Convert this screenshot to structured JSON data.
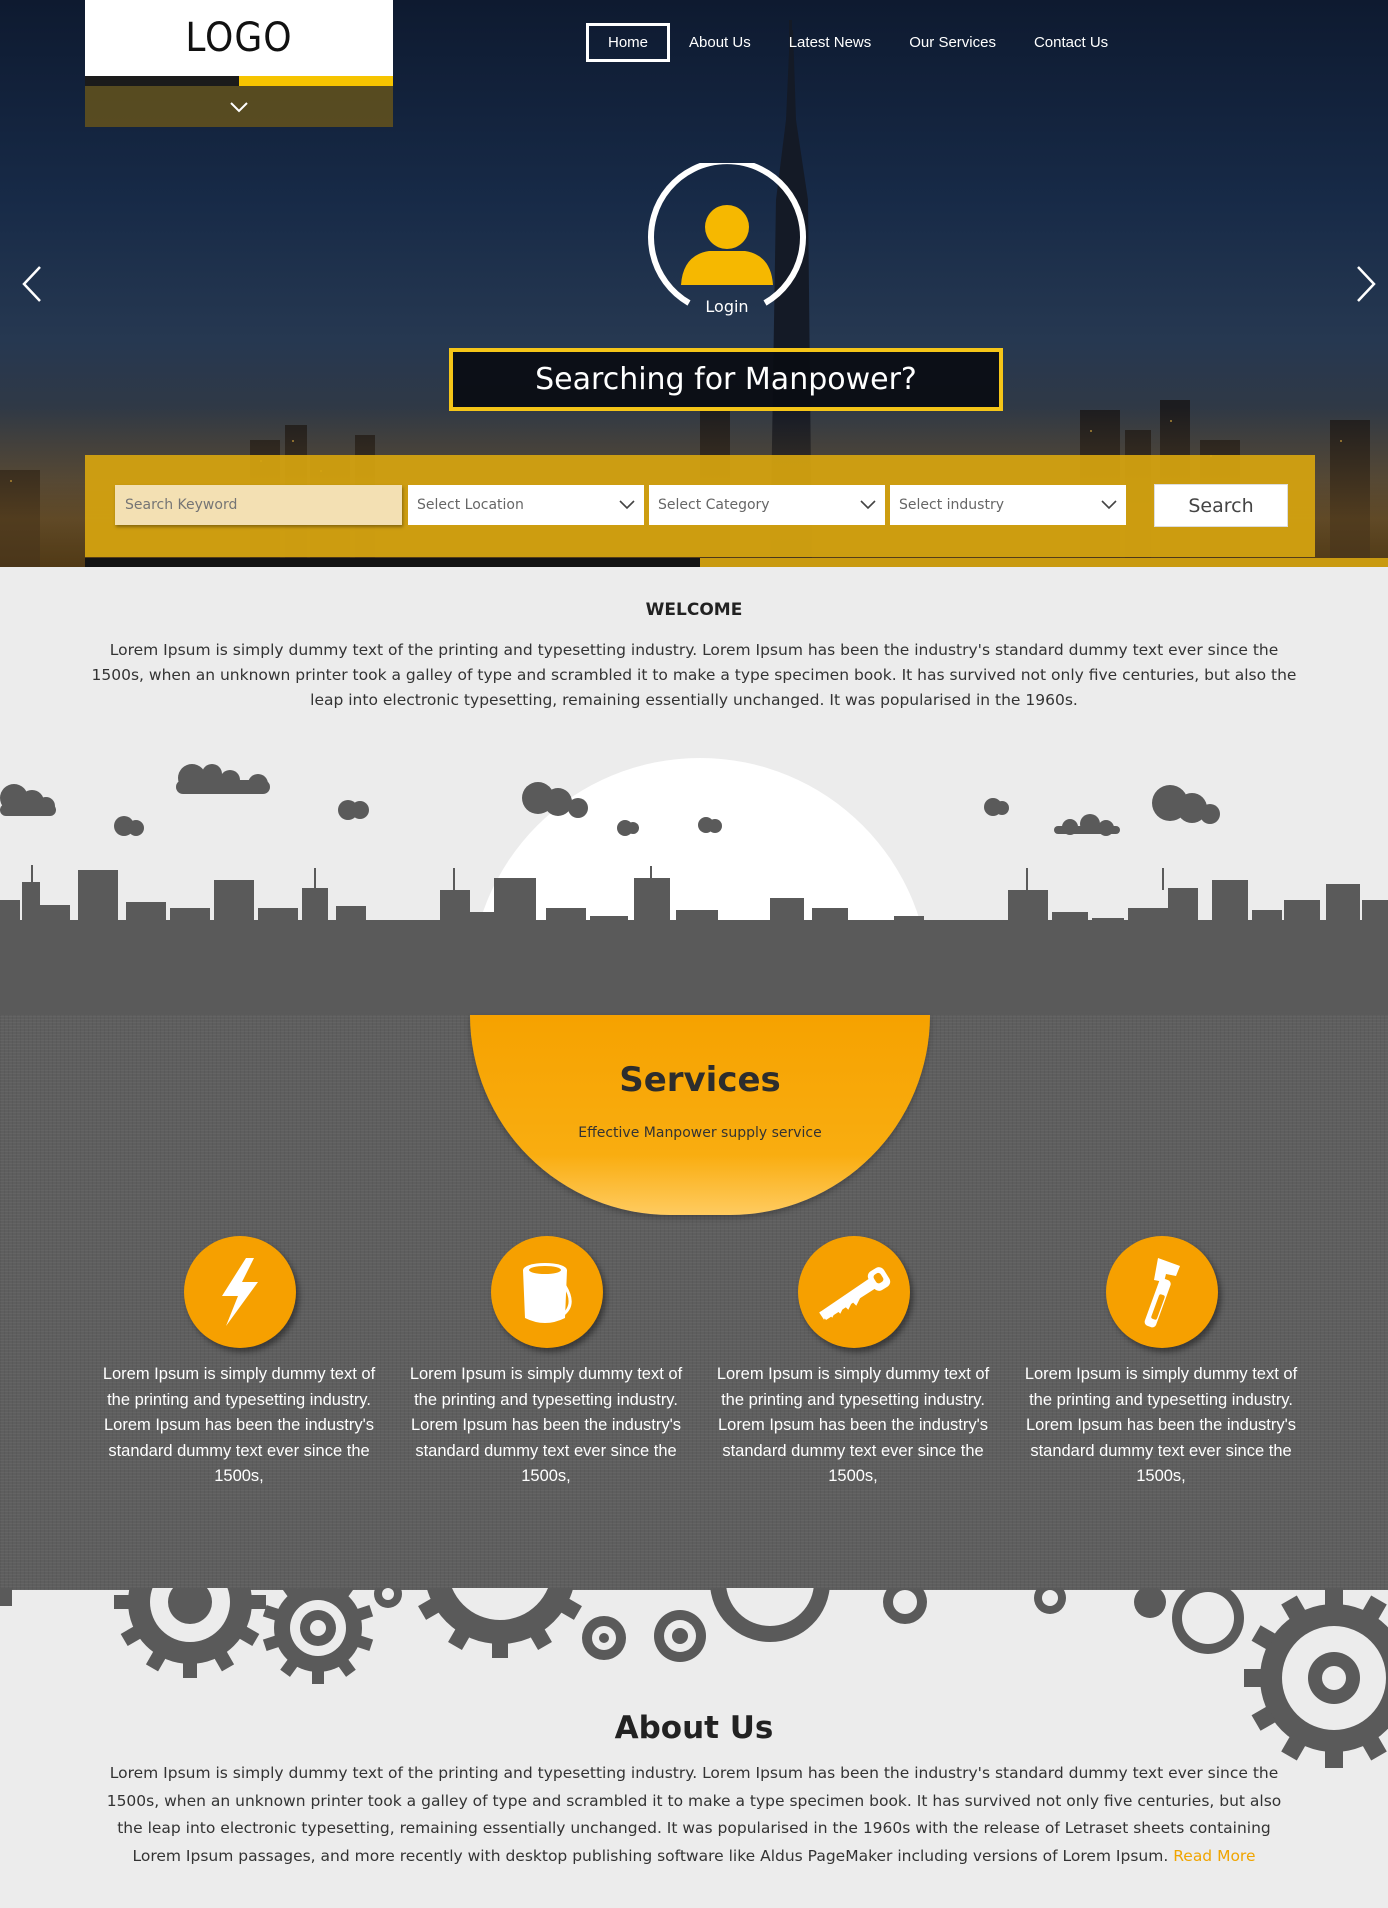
{
  "header": {
    "logo": "LOGO",
    "nav": [
      "Home",
      "About Us",
      "Latest News",
      "Our Services",
      "Contact Us"
    ],
    "active_nav": "Home"
  },
  "hero": {
    "login_label": "Login",
    "tagline": "Searching for Manpower?"
  },
  "search": {
    "keyword_placeholder": "Search Keyword",
    "location": "Select Location",
    "category": "Select Category",
    "industry": "Select industry",
    "button": "Search"
  },
  "welcome": {
    "title": "WELCOME",
    "text": "Lorem Ipsum is simply dummy text of the printing and typesetting industry. Lorem Ipsum has been the industry's standard dummy text ever since the 1500s, when an unknown printer took a galley of type and scrambled it to make a type specimen book. It has survived not only five centuries, but also the leap into electronic typesetting, remaining essentially unchanged. It was popularised in the 1960s."
  },
  "services": {
    "title": "Services",
    "subtitle": "Effective Manpower supply service",
    "items": [
      {
        "icon": "lightning-icon",
        "text": "Lorem Ipsum is simply dummy text of the printing and typesetting industry. Lorem Ipsum has been the industry's standard dummy text ever since the 1500s,"
      },
      {
        "icon": "paint-bucket-icon",
        "text": "Lorem Ipsum is simply dummy text of the printing and typesetting industry. Lorem Ipsum has been the industry's standard dummy text ever since the 1500s,"
      },
      {
        "icon": "saw-icon",
        "text": "Lorem Ipsum is simply dummy text of the printing and typesetting industry. Lorem Ipsum has been the industry's standard dummy text ever since the 1500s,"
      },
      {
        "icon": "wrench-icon",
        "text": "Lorem Ipsum is simply dummy text of the printing and typesetting industry. Lorem Ipsum has been the industry's standard dummy text ever since the 1500s,"
      }
    ]
  },
  "about": {
    "title": "About Us",
    "text": "Lorem Ipsum is simply dummy text of the printing and typesetting industry. Lorem Ipsum has been the industry's standard dummy text ever since the 1500s, when an unknown printer took a galley of type and scrambled it to make a type specimen book. It has survived not only five centuries, but also the leap into electronic typesetting, remaining essentially unchanged. It was popularised in the 1960s with the release of Letraset sheets containing Lorem Ipsum passages, and more recently with desktop publishing software like Aldus PageMaker including versions of Lorem Ipsum.",
    "read_more": "Read More"
  },
  "colors": {
    "accent": "#f6a000",
    "gold": "#f5c518",
    "panel": "#5e5e5e"
  }
}
